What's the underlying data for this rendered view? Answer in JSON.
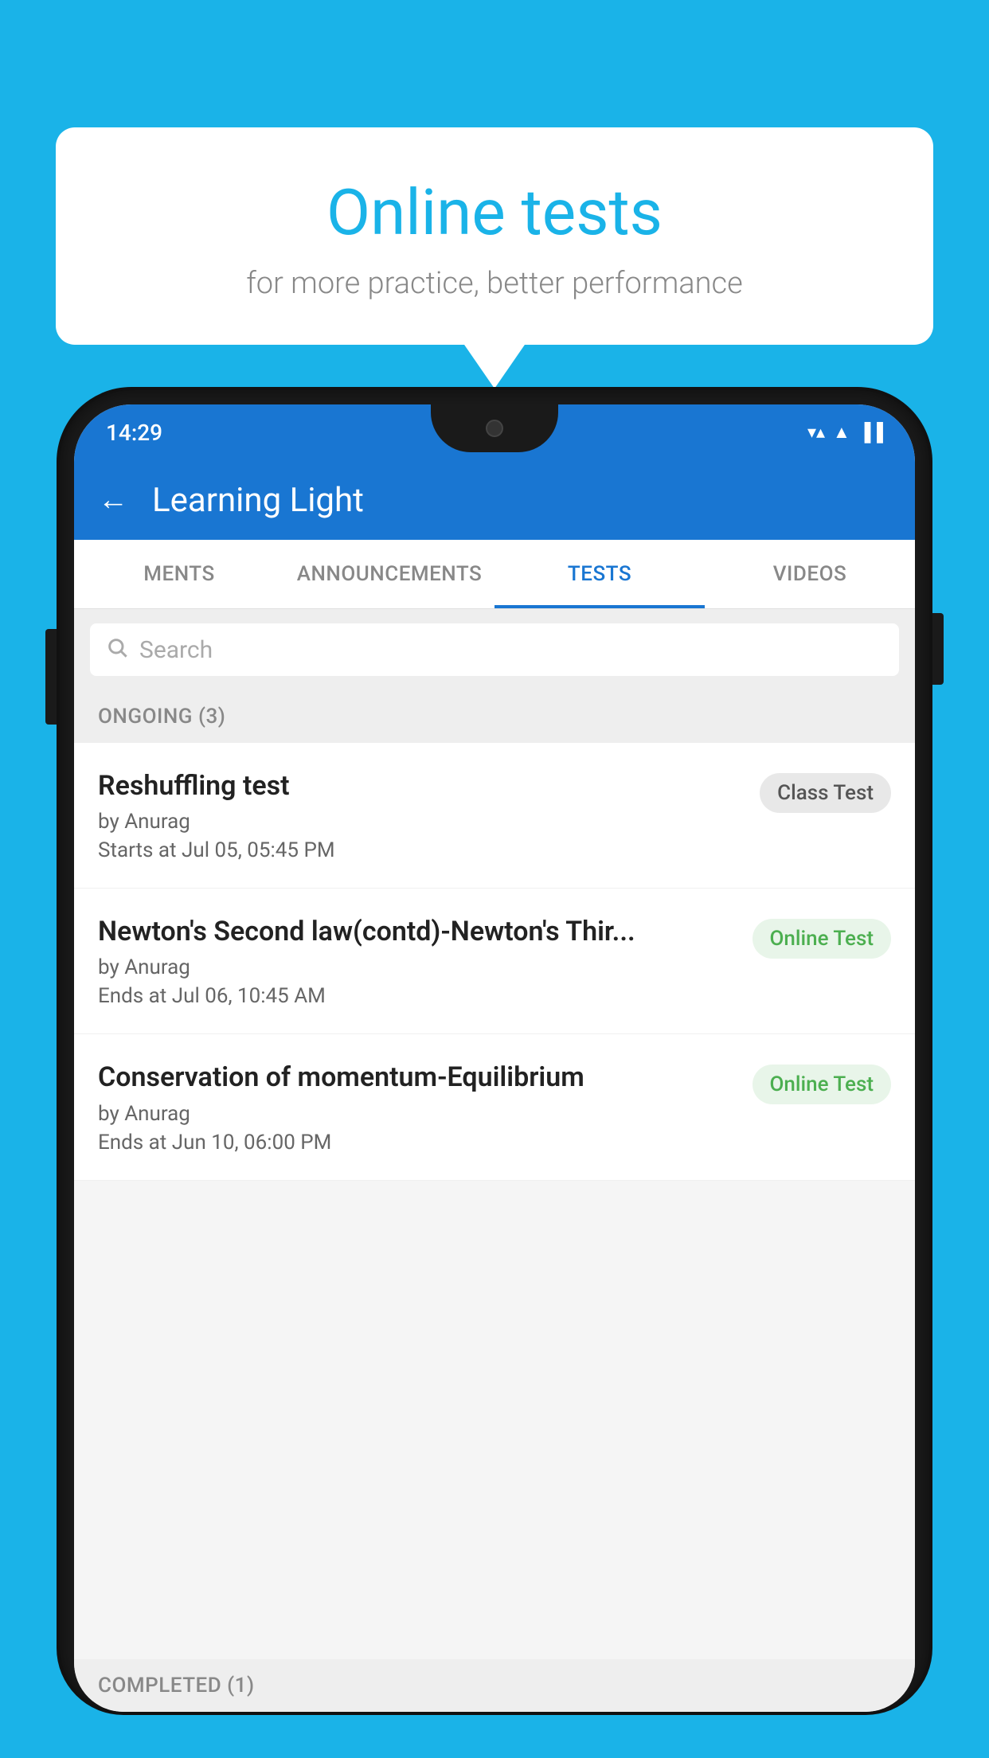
{
  "background_color": "#1ab3e8",
  "speech_bubble": {
    "title": "Online tests",
    "subtitle": "for more practice, better performance"
  },
  "phone": {
    "status_bar": {
      "time": "14:29",
      "wifi": "▼",
      "signal": "▲",
      "battery": "▐"
    },
    "app_bar": {
      "title": "Learning Light",
      "back_label": "←"
    },
    "tabs": [
      {
        "label": "MENTS",
        "active": false
      },
      {
        "label": "ANNOUNCEMENTS",
        "active": false
      },
      {
        "label": "TESTS",
        "active": true
      },
      {
        "label": "VIDEOS",
        "active": false
      }
    ],
    "search": {
      "placeholder": "Search"
    },
    "ongoing_section": {
      "label": "ONGOING (3)"
    },
    "tests": [
      {
        "title": "Reshuffling test",
        "author": "by Anurag",
        "time_label": "Starts at",
        "time": "Jul 05, 05:45 PM",
        "badge": "Class Test",
        "badge_type": "class"
      },
      {
        "title": "Newton's Second law(contd)-Newton's Thir...",
        "author": "by Anurag",
        "time_label": "Ends at",
        "time": "Jul 06, 10:45 AM",
        "badge": "Online Test",
        "badge_type": "online"
      },
      {
        "title": "Conservation of momentum-Equilibrium",
        "author": "by Anurag",
        "time_label": "Ends at",
        "time": "Jun 10, 06:00 PM",
        "badge": "Online Test",
        "badge_type": "online"
      }
    ],
    "completed_section": {
      "label": "COMPLETED (1)"
    }
  }
}
